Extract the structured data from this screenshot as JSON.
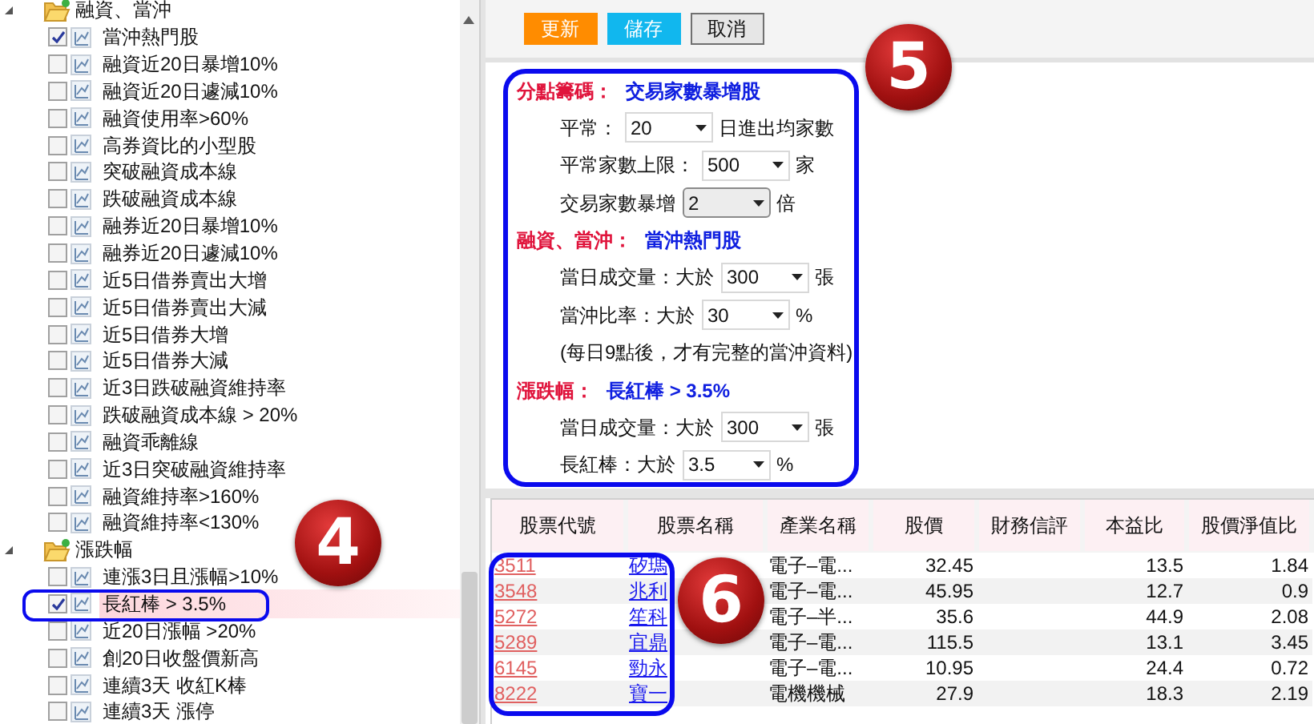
{
  "tree": [
    {
      "label": "融資、當沖",
      "expanded": true,
      "children": [
        {
          "label": "當沖熱門股",
          "checked": true,
          "selected": false
        },
        {
          "label": "融資近20日暴增10%",
          "checked": false,
          "selected": false
        },
        {
          "label": "融資近20日遽減10%",
          "checked": false,
          "selected": false
        },
        {
          "label": "融資使用率>60%",
          "checked": false,
          "selected": false
        },
        {
          "label": "高券資比的小型股",
          "checked": false,
          "selected": false
        },
        {
          "label": "突破融資成本線",
          "checked": false,
          "selected": false
        },
        {
          "label": "跌破融資成本線",
          "checked": false,
          "selected": false
        },
        {
          "label": "融券近20日暴增10%",
          "checked": false,
          "selected": false
        },
        {
          "label": "融券近20日遽減10%",
          "checked": false,
          "selected": false
        },
        {
          "label": "近5日借券賣出大增",
          "checked": false,
          "selected": false
        },
        {
          "label": "近5日借券賣出大減",
          "checked": false,
          "selected": false
        },
        {
          "label": "近5日借券大增",
          "checked": false,
          "selected": false
        },
        {
          "label": "近5日借券大減",
          "checked": false,
          "selected": false
        },
        {
          "label": "近3日跌破融資維持率",
          "checked": false,
          "selected": false
        },
        {
          "label": "跌破融資成本線 > 20%",
          "checked": false,
          "selected": false
        },
        {
          "label": "融資乖離線",
          "checked": false,
          "selected": false
        },
        {
          "label": "近3日突破融資維持率",
          "checked": false,
          "selected": false
        },
        {
          "label": "融資維持率>160%",
          "checked": false,
          "selected": false
        },
        {
          "label": "融資維持率<130%",
          "checked": false,
          "selected": false
        }
      ]
    },
    {
      "label": "漲跌幅",
      "expanded": true,
      "children": [
        {
          "label": "連漲3日且漲幅>10%",
          "checked": false,
          "selected": false
        },
        {
          "label": "長紅棒 > 3.5%",
          "checked": true,
          "selected": true
        },
        {
          "label": "近20日漲幅 >20%",
          "checked": false,
          "selected": false
        },
        {
          "label": "創20日收盤價新高",
          "checked": false,
          "selected": false
        },
        {
          "label": "連續3天 收紅K棒",
          "checked": false,
          "selected": false
        },
        {
          "label": "連續3天 漲停",
          "checked": false,
          "selected": false
        }
      ]
    }
  ],
  "toolbar": [
    {
      "label": "更新",
      "kind": "primary"
    },
    {
      "label": "儲存",
      "kind": "accent"
    },
    {
      "label": "取消",
      "kind": "plain"
    }
  ],
  "settings": [
    {
      "label": "分點籌碼：",
      "value": "交易家數暴增股",
      "rows": [
        {
          "kind": "select",
          "prefix": "平常：",
          "value": "20",
          "suffix": "日進出均家數"
        },
        {
          "kind": "select",
          "prefix": "平常家數上限：",
          "value": "500",
          "suffix": "家"
        },
        {
          "kind": "select",
          "prefix": "交易家數暴增",
          "value": "2",
          "suffix": "倍",
          "raised": true
        }
      ]
    },
    {
      "label": "融資、當沖：",
      "value": "當沖熱門股",
      "rows": [
        {
          "kind": "select",
          "prefix": "當日成交量：大於",
          "value": "300",
          "suffix": "張"
        },
        {
          "kind": "select",
          "prefix": "當沖比率：大於",
          "value": "30",
          "suffix": "%"
        },
        {
          "kind": "note",
          "text": "(每日9點後，才有完整的當沖資料)"
        }
      ]
    },
    {
      "label": "漲跌幅：",
      "value": "長紅棒 > 3.5%",
      "rows": [
        {
          "kind": "select",
          "prefix": "當日成交量：大於",
          "value": "300",
          "suffix": "張"
        },
        {
          "kind": "select",
          "prefix": "長紅棒：大於",
          "value": "3.5",
          "suffix": "%"
        }
      ]
    }
  ],
  "table": {
    "columns": [
      "股票代號",
      "股票名稱",
      "產業名稱",
      "股價",
      "財務信評",
      "本益比",
      "股價淨值比"
    ],
    "rows": [
      [
        "3511",
        "矽瑪",
        "電子–電...",
        "32.45",
        "",
        "13.5",
        "1.84"
      ],
      [
        "3548",
        "兆利",
        "電子–電...",
        "45.95",
        "",
        "12.7",
        "0.9"
      ],
      [
        "5272",
        "笙科",
        "電子–半...",
        "35.6",
        "",
        "44.9",
        "2.08"
      ],
      [
        "5289",
        "宜鼎",
        "電子–電...",
        "115.5",
        "",
        "13.1",
        "3.45"
      ],
      [
        "6145",
        "勁永",
        "電子–電...",
        "10.95",
        "",
        "24.4",
        "0.72"
      ],
      [
        "8222",
        "寶一",
        "電機機械",
        "27.9",
        "",
        "18.3",
        "2.19"
      ]
    ]
  },
  "annotations": [
    {
      "label": "4"
    },
    {
      "label": "5"
    },
    {
      "label": "6"
    }
  ]
}
